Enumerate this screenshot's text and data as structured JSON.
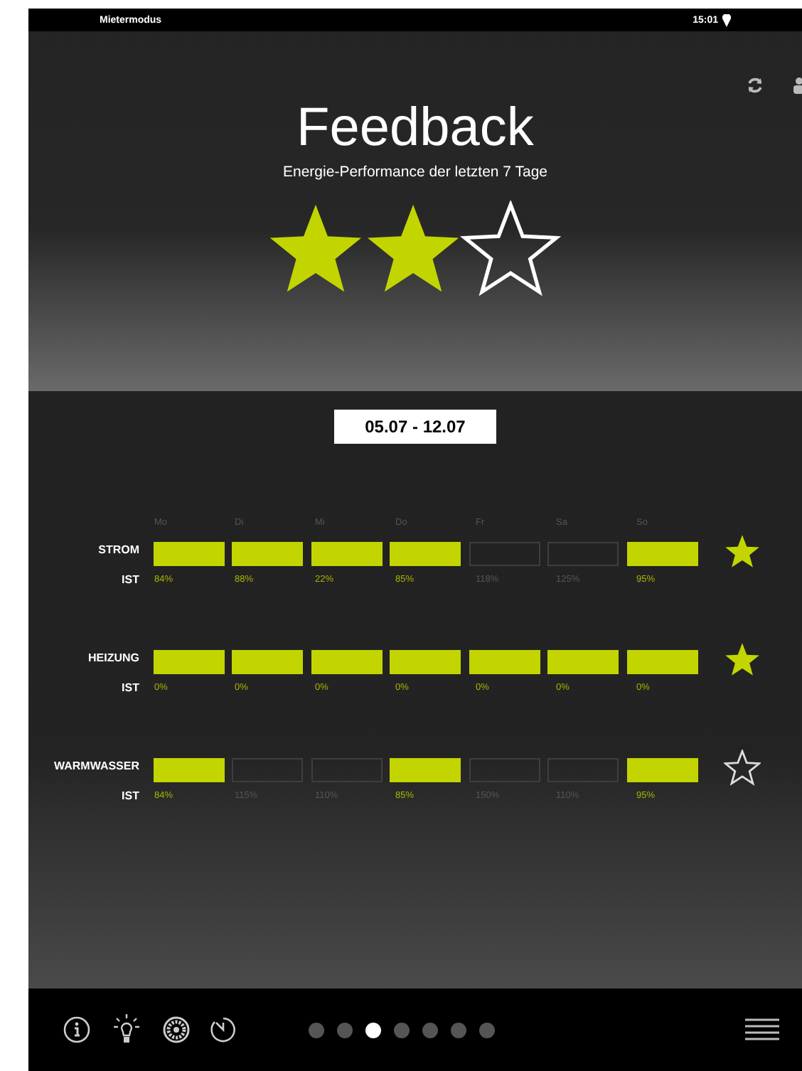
{
  "status_bar": {
    "carrier": "Mietermodus",
    "time": "15:01"
  },
  "header": {
    "title": "Feedback",
    "subtitle": "Energie-Performance der letzten 7 Tage",
    "stars": 2
  },
  "date_range": "05.07 - 12.07",
  "days": [
    "Mo",
    "Di",
    "Mi",
    "Do",
    "Fr",
    "Sa",
    "So"
  ],
  "rows": [
    {
      "name": "STROM",
      "sub": "IST",
      "star": true,
      "cells": [
        {
          "filled": true,
          "value": "84%"
        },
        {
          "filled": true,
          "value": "88%"
        },
        {
          "filled": true,
          "value": "22%"
        },
        {
          "filled": true,
          "value": "85%"
        },
        {
          "filled": false,
          "value": "118%"
        },
        {
          "filled": false,
          "value": "125%"
        },
        {
          "filled": true,
          "value": "95%"
        }
      ]
    },
    {
      "name": "HEIZUNG",
      "sub": "IST",
      "star": true,
      "cells": [
        {
          "filled": true,
          "value": "0%"
        },
        {
          "filled": true,
          "value": "0%"
        },
        {
          "filled": true,
          "value": "0%"
        },
        {
          "filled": true,
          "value": "0%"
        },
        {
          "filled": true,
          "value": "0%"
        },
        {
          "filled": true,
          "value": "0%"
        },
        {
          "filled": true,
          "value": "0%"
        }
      ]
    },
    {
      "name": "WARMWASSER",
      "sub": "IST",
      "star": false,
      "cells": [
        {
          "filled": true,
          "value": "84%"
        },
        {
          "filled": false,
          "value": "115%"
        },
        {
          "filled": false,
          "value": "110%"
        },
        {
          "filled": true,
          "value": "85%"
        },
        {
          "filled": false,
          "value": "150%"
        },
        {
          "filled": false,
          "value": "110%"
        },
        {
          "filled": true,
          "value": "95%"
        }
      ]
    }
  ],
  "pages": [
    {
      "selected": false
    },
    {
      "selected": false
    },
    {
      "selected": true
    },
    {
      "selected": false
    },
    {
      "selected": false
    },
    {
      "selected": false
    },
    {
      "selected": false
    }
  ]
}
